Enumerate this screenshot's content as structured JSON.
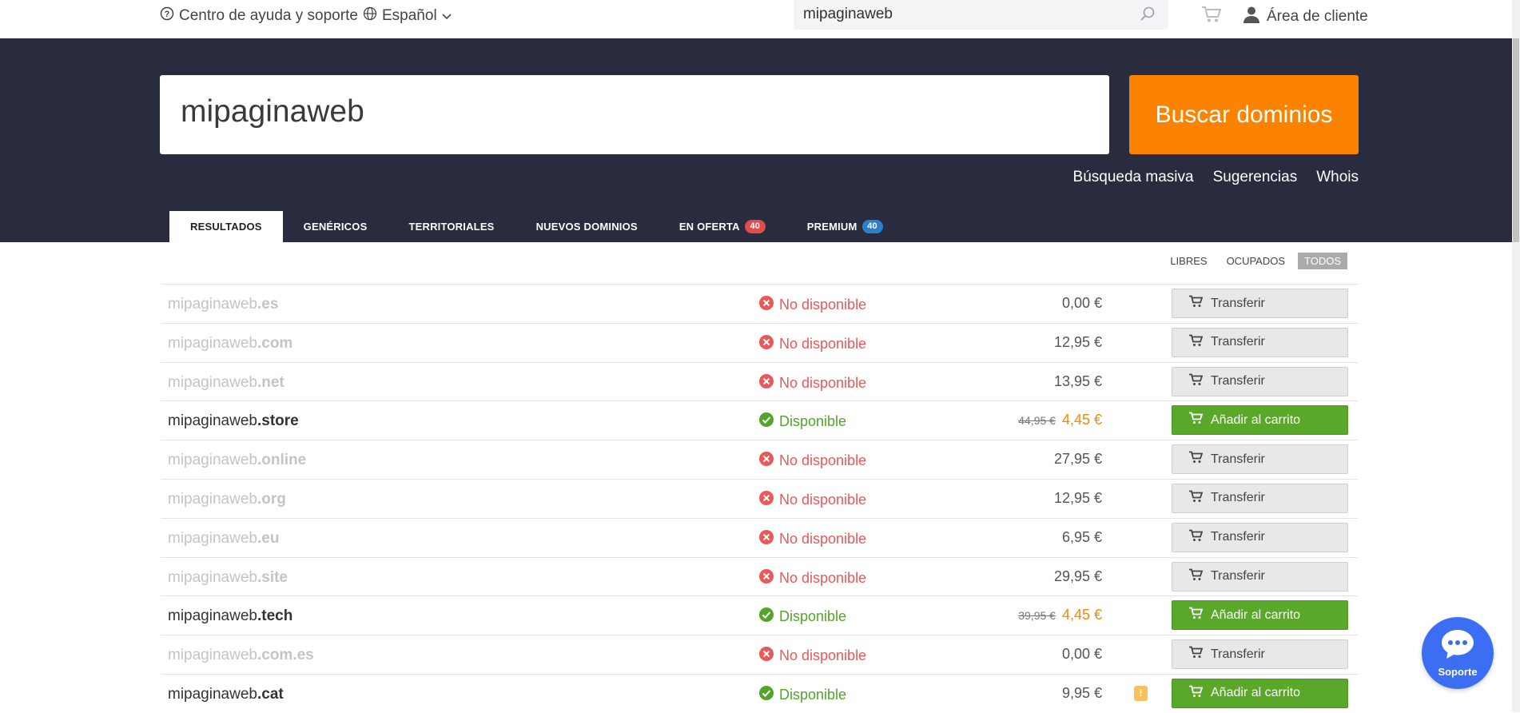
{
  "topbar": {
    "help_label": "Centro de ayuda y soporte",
    "language": "Español",
    "search_value": "mipaginaweb",
    "client_area": "Área de cliente"
  },
  "hero": {
    "search_value": "mipaginaweb",
    "search_button": "Buscar dominios",
    "links": [
      "Búsqueda masiva",
      "Sugerencias",
      "Whois"
    ]
  },
  "tabs": [
    {
      "label": "RESULTADOS",
      "active": true
    },
    {
      "label": "GENÉRICOS"
    },
    {
      "label": "TERRITORIALES"
    },
    {
      "label": "NUEVOS DOMINIOS"
    },
    {
      "label": "EN OFERTA",
      "badge": "40",
      "badge_color": "#e24b4b"
    },
    {
      "label": "PREMIUM",
      "badge": "40",
      "badge_color": "#2d7fc8"
    }
  ],
  "filters": {
    "free": "LIBRES",
    "taken": "OCUPADOS",
    "all": "TODOS",
    "selected": "TODOS"
  },
  "results": [
    {
      "name": "mipaginaweb",
      "tld": ".es",
      "available": false,
      "status": "No disponible",
      "price": "0,00 €",
      "action": "Transferir"
    },
    {
      "name": "mipaginaweb",
      "tld": ".com",
      "available": false,
      "status": "No disponible",
      "price": "12,95 €",
      "action": "Transferir"
    },
    {
      "name": "mipaginaweb",
      "tld": ".net",
      "available": false,
      "status": "No disponible",
      "price": "13,95 €",
      "action": "Transferir"
    },
    {
      "name": "mipaginaweb",
      "tld": ".store",
      "available": true,
      "status": "Disponible",
      "old_price": "44,95 €",
      "price": "4,45 €",
      "action": "Añadir al carrito"
    },
    {
      "name": "mipaginaweb",
      "tld": ".online",
      "available": false,
      "status": "No disponible",
      "price": "27,95 €",
      "action": "Transferir"
    },
    {
      "name": "mipaginaweb",
      "tld": ".org",
      "available": false,
      "status": "No disponible",
      "price": "12,95 €",
      "action": "Transferir"
    },
    {
      "name": "mipaginaweb",
      "tld": ".eu",
      "available": false,
      "status": "No disponible",
      "price": "6,95 €",
      "action": "Transferir"
    },
    {
      "name": "mipaginaweb",
      "tld": ".site",
      "available": false,
      "status": "No disponible",
      "price": "29,95 €",
      "action": "Transferir"
    },
    {
      "name": "mipaginaweb",
      "tld": ".tech",
      "available": true,
      "status": "Disponible",
      "old_price": "39,95 €",
      "price": "4,45 €",
      "action": "Añadir al carrito"
    },
    {
      "name": "mipaginaweb",
      "tld": ".com.es",
      "available": false,
      "status": "No disponible",
      "price": "0,00 €",
      "action": "Transferir"
    },
    {
      "name": "mipaginaweb",
      "tld": ".cat",
      "available": true,
      "status": "Disponible",
      "price": "9,95 €",
      "action": "Añadir al carrito",
      "info_badge": "!"
    }
  ],
  "support_label": "Soporte",
  "colors": {
    "hero_bg": "#282c3e",
    "accent": "#fb8300",
    "available": "#53a529",
    "unavailable": "#ea5858",
    "offer_price": "#f08a08",
    "support": "#3b6ef3"
  },
  "icons": {
    "help": "help-circle-icon",
    "language": "globe-icon",
    "search": "magnifier-icon",
    "cart": "cart-icon",
    "user": "user-icon",
    "unavailable": "x-circle-icon",
    "available": "check-circle-icon",
    "support": "chat-bubble-icon"
  }
}
